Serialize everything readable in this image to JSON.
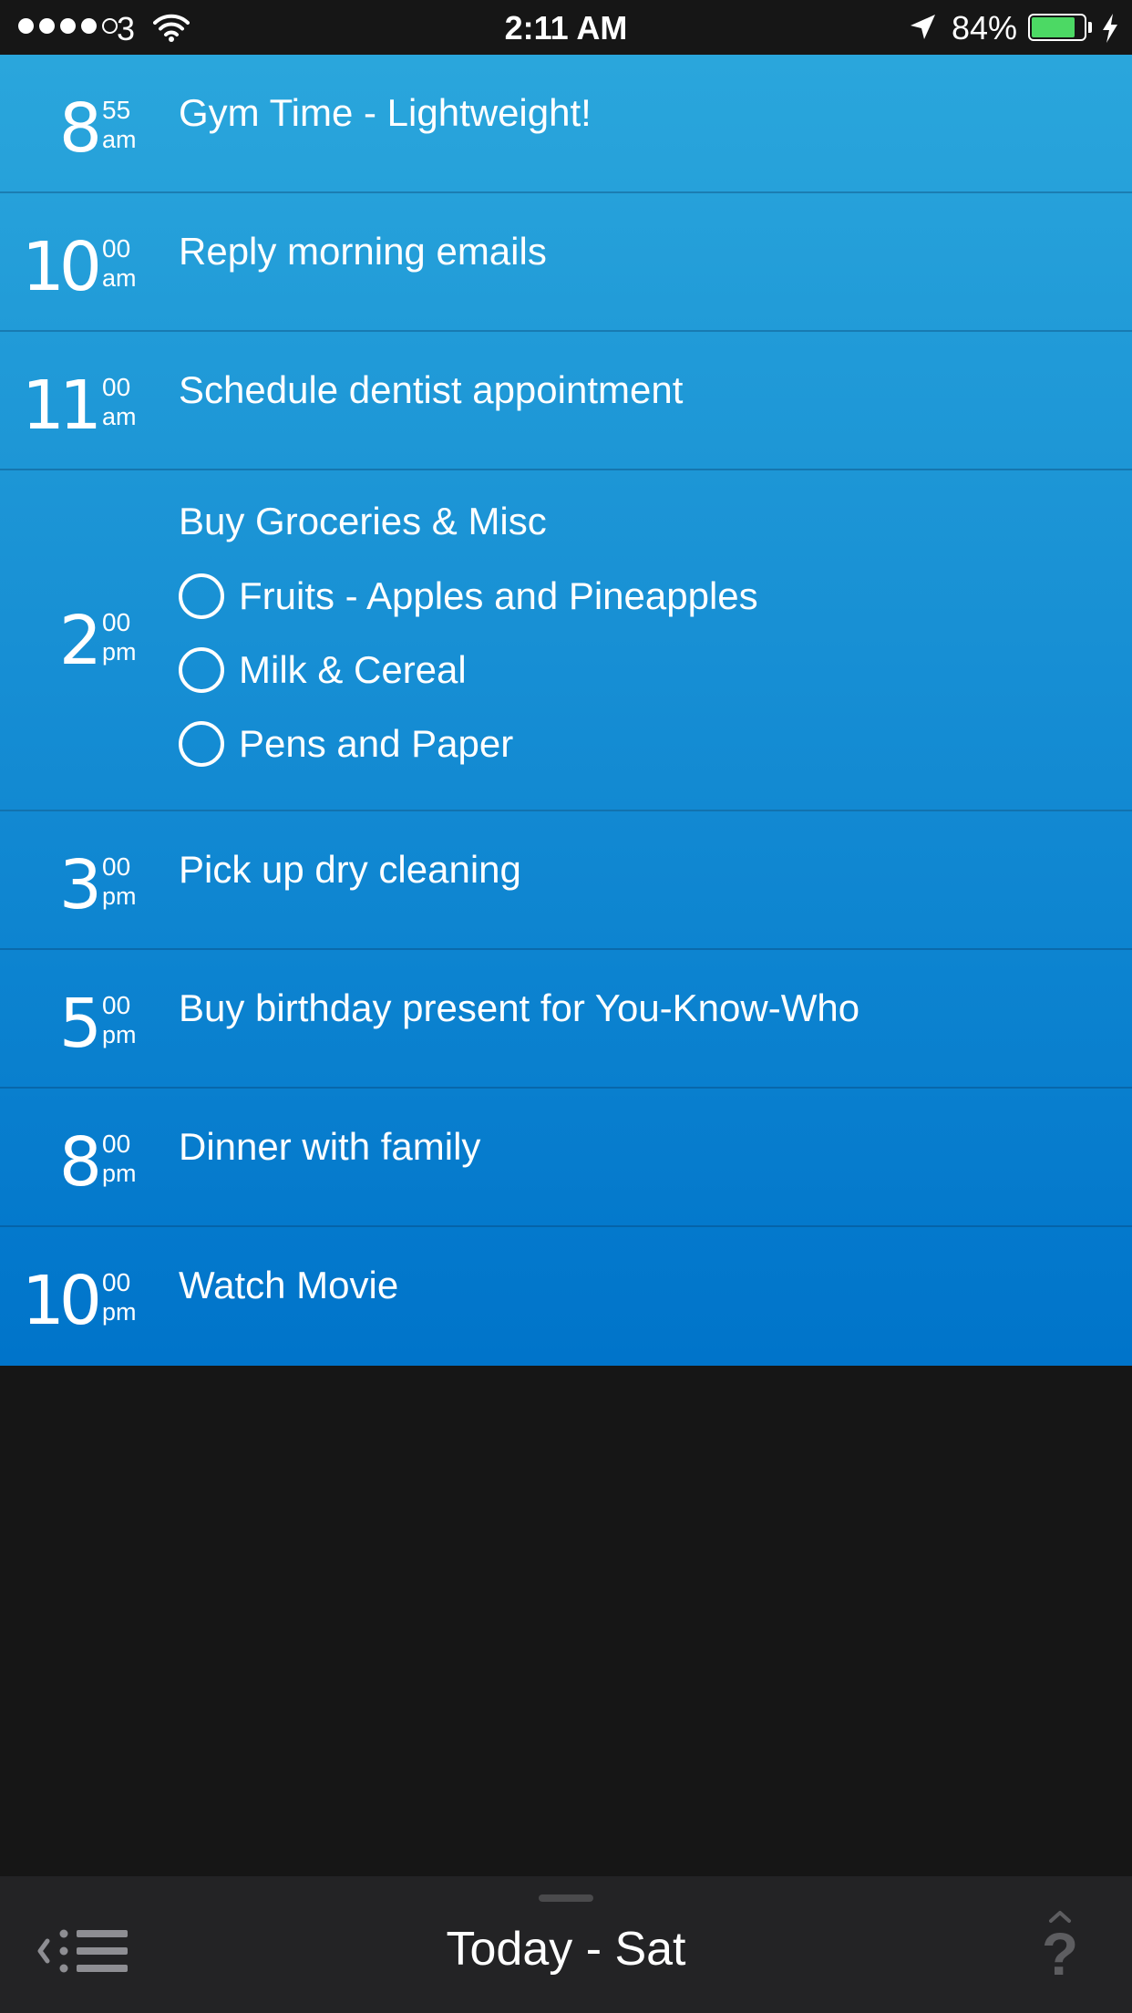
{
  "status_bar": {
    "carrier": "3",
    "time": "2:11 AM",
    "battery": "84%",
    "battery_level": 0.84,
    "icons": [
      "signal-dots-icon",
      "wifi-icon",
      "location-arrow-icon",
      "battery-icon",
      "charging-bolt-icon"
    ]
  },
  "colors": {
    "row_top": "#2aa6dc",
    "row_bottom": "#0074ca",
    "background": "#161616",
    "footer": "#232325"
  },
  "tasks": [
    {
      "hour": "8",
      "minute": "55",
      "meridiem": "am",
      "title": "Gym Time - Lightweight!"
    },
    {
      "hour": "10",
      "minute": "00",
      "meridiem": "am",
      "title": "Reply morning emails"
    },
    {
      "hour": "11",
      "minute": "00",
      "meridiem": "am",
      "title": "Schedule dentist appointment"
    },
    {
      "hour": "2",
      "minute": "00",
      "meridiem": "pm",
      "title": "Buy Groceries & Misc",
      "subtasks": [
        "Fruits - Apples and Pineapples",
        "Milk & Cereal",
        "Pens and Paper"
      ]
    },
    {
      "hour": "3",
      "minute": "00",
      "meridiem": "pm",
      "title": "Pick up dry cleaning"
    },
    {
      "hour": "5",
      "minute": "00",
      "meridiem": "pm",
      "title": "Buy birthday present for You-Know-Who"
    },
    {
      "hour": "8",
      "minute": "00",
      "meridiem": "pm",
      "title": "Dinner with family"
    },
    {
      "hour": "10",
      "minute": "00",
      "meridiem": "pm",
      "title": "Watch Movie"
    }
  ],
  "footer": {
    "title": "Today - Sat",
    "left_icon": "back-list-icon",
    "right_icon": "help-icon",
    "right_label": "?"
  }
}
